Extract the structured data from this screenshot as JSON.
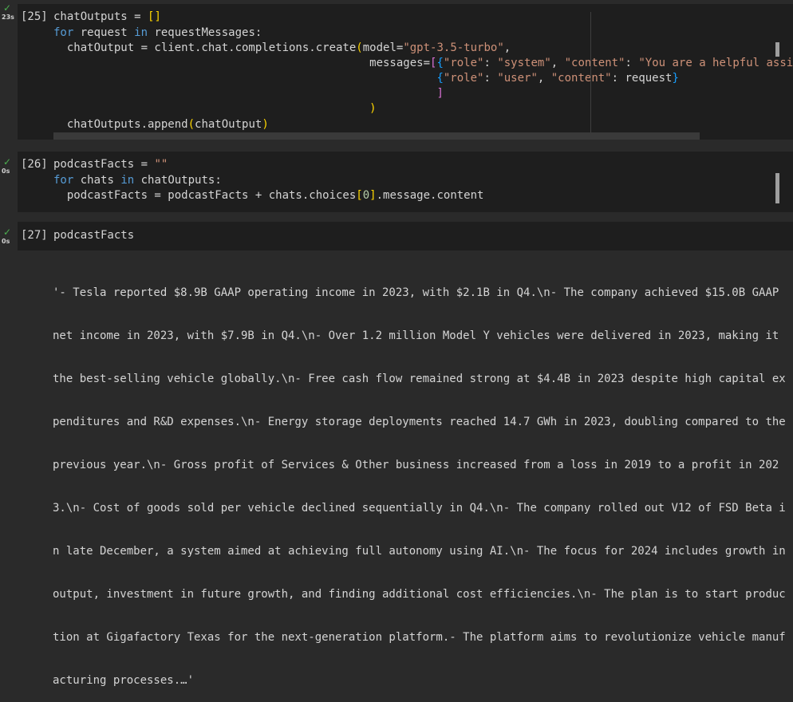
{
  "cells": [
    {
      "exec_count": "[25]",
      "time": "23s",
      "lines": [
        "chatOutputs = []",
        "for request in requestMessages:",
        "  chatOutput = client.chat.completions.create(model=\"gpt-3.5-turbo\",",
        "                                               messages=[{\"role\": \"system\", \"content\": \"You are a helpful assist",
        "                                                         {\"role\": \"user\", \"content\": request}",
        "                                                         ]",
        "                                               )",
        "  chatOutputs.append(chatOutput)"
      ]
    },
    {
      "exec_count": "[26]",
      "time": "0s",
      "lines": [
        "podcastFacts = \"\"",
        "for chats in chatOutputs:",
        "  podcastFacts = podcastFacts + chats.choices[0].message.content"
      ]
    },
    {
      "exec_count": "[27]",
      "time": "0s",
      "lines": [
        "podcastFacts"
      ]
    }
  ],
  "output_lines": [
    "'- Tesla reported $8.9B GAAP operating income in 2023, with $2.1B in Q4.\\n- The company achieved $15.0B GAAP",
    "net income in 2023, with $7.9B in Q4.\\n- Over 1.2 million Model Y vehicles were delivered in 2023, making it",
    "the best-selling vehicle globally.\\n- Free cash flow remained strong at $4.4B in 2023 despite high capital ex",
    "penditures and R&D expenses.\\n- Energy storage deployments reached 14.7 GWh in 2023, doubling compared to the",
    "previous year.\\n- Gross profit of Services & Other business increased from a loss in 2019 to a profit in 202",
    "3.\\n- Cost of goods sold per vehicle declined sequentially in Q4.\\n- The company rolled out V12 of FSD Beta i",
    "n late December, a system aimed at achieving full autonomy using AI.\\n- The focus for 2024 includes growth in",
    "output, investment in future growth, and finding additional cost efficiencies.\\n- The plan is to start produc",
    "tion at Gigafactory Texas for the next-generation platform.- The platform aims to revolutionize vehicle manuf",
    "acturing processes.…'"
  ],
  "icons": {
    "status": "check-icon"
  },
  "colors": {
    "keyword": "#569cd6",
    "string": "#ce9178",
    "success": "#4caf50"
  }
}
